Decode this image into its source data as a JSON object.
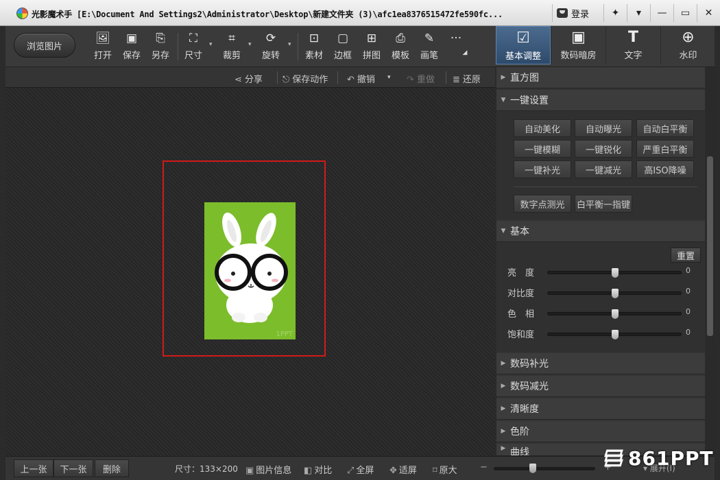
{
  "titlebar": {
    "app_name": "光影魔术手",
    "path": "[E:\\Document And Settings2\\Administrator\\Desktop\\新建文件夹 (3)\\afc1ea8376515472fe590fc...",
    "login_label": "登录",
    "icons": [
      "app-logo-icon",
      "user-icon",
      "skin-icon",
      "menu-icon",
      "minimize-icon",
      "maximize-icon",
      "close-icon"
    ]
  },
  "toolbar": {
    "browse_label": "浏览图片",
    "tools": [
      {
        "label": "打开",
        "icon": "open-icon"
      },
      {
        "label": "保存",
        "icon": "save-icon"
      },
      {
        "label": "另存",
        "icon": "save-as-icon"
      },
      {
        "label": "尺寸",
        "icon": "resize-icon"
      },
      {
        "label": "裁剪",
        "icon": "crop-icon"
      },
      {
        "label": "旋转",
        "icon": "rotate-icon"
      },
      {
        "label": "素材",
        "icon": "material-icon"
      },
      {
        "label": "边框",
        "icon": "border-icon"
      },
      {
        "label": "拼图",
        "icon": "collage-icon"
      },
      {
        "label": "模板",
        "icon": "template-icon"
      },
      {
        "label": "画笔",
        "icon": "brush-icon"
      }
    ],
    "more": "···",
    "tabs": [
      {
        "label": "基本调整",
        "icon": "adjust-icon",
        "active": true
      },
      {
        "label": "数码暗房",
        "icon": "darkroom-icon",
        "active": false
      },
      {
        "label": "文字",
        "icon": "text-icon",
        "active": false
      },
      {
        "label": "水印",
        "icon": "watermark-icon",
        "active": false
      }
    ]
  },
  "subbar": {
    "share": "分享",
    "save_action": "保存动作",
    "undo": "撤销",
    "redo": "重做",
    "restore": "还原"
  },
  "canvas": {
    "photo_color": "#7cbd2b",
    "photo_mark": "1PPT"
  },
  "panel": {
    "histogram": "直方图",
    "one_click": {
      "title": "一键设置",
      "buttons": [
        "自动美化",
        "自动曝光",
        "自动白平衡",
        "一键模糊",
        "一键锐化",
        "严重白平衡",
        "一键补光",
        "一键减光",
        "高ISO降噪"
      ],
      "extra_buttons": [
        "数字点测光",
        "白平衡一指键"
      ]
    },
    "basic": {
      "title": "基本",
      "reset": "重置",
      "sliders": [
        {
          "label": "亮　度",
          "value": "0"
        },
        {
          "label": "对比度",
          "value": "0"
        },
        {
          "label": "色　相",
          "value": "0"
        },
        {
          "label": "饱和度",
          "value": "0"
        }
      ]
    },
    "collapsed": [
      "数码补光",
      "数码减光",
      "清晰度",
      "色阶",
      "曲线"
    ]
  },
  "statusbar": {
    "prev": "上一张",
    "next": "下一张",
    "delete": "删除",
    "size": "尺寸：133×200",
    "info": "图片信息",
    "compare": "对比",
    "fullscreen": "全屏",
    "fit": "适屏",
    "original": "原大",
    "zoom_minus": "−",
    "zoom_plus": "+",
    "expand": "展开(I)"
  },
  "watermark": "861PPT",
  "colors": {
    "accent_tab": "#3d5f86",
    "selection": "#d31a1a"
  }
}
